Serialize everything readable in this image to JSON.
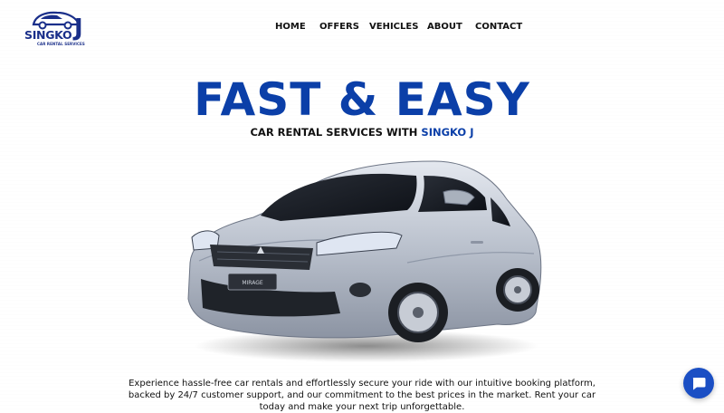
{
  "brand": {
    "name": "SINGKO",
    "letter": "J",
    "tagline": "CAR RENTAL SERVICES"
  },
  "nav": {
    "items": [
      {
        "label": "HOME"
      },
      {
        "label": "OFFERS"
      },
      {
        "label": "VEHICLES"
      },
      {
        "label": "ABOUT"
      },
      {
        "label": "CONTACT"
      }
    ]
  },
  "hero": {
    "title": "FAST & EASY",
    "subtitle_prefix": "CAR RENTAL SERVICES WITH ",
    "subtitle_brand": "SINGKO J",
    "description": "Experience hassle-free car rentals and effortlessly secure your ride with our intuitive booking platform, backed by 24/7 customer support, and our commitment to the best prices in the market. Rent your car today and make your next trip unforgettable."
  },
  "chat": {
    "icon": "chat-icon"
  },
  "colors": {
    "accent": "#0b3fa8",
    "logo": "#1a2f8a",
    "chat": "#1b4fc4"
  }
}
